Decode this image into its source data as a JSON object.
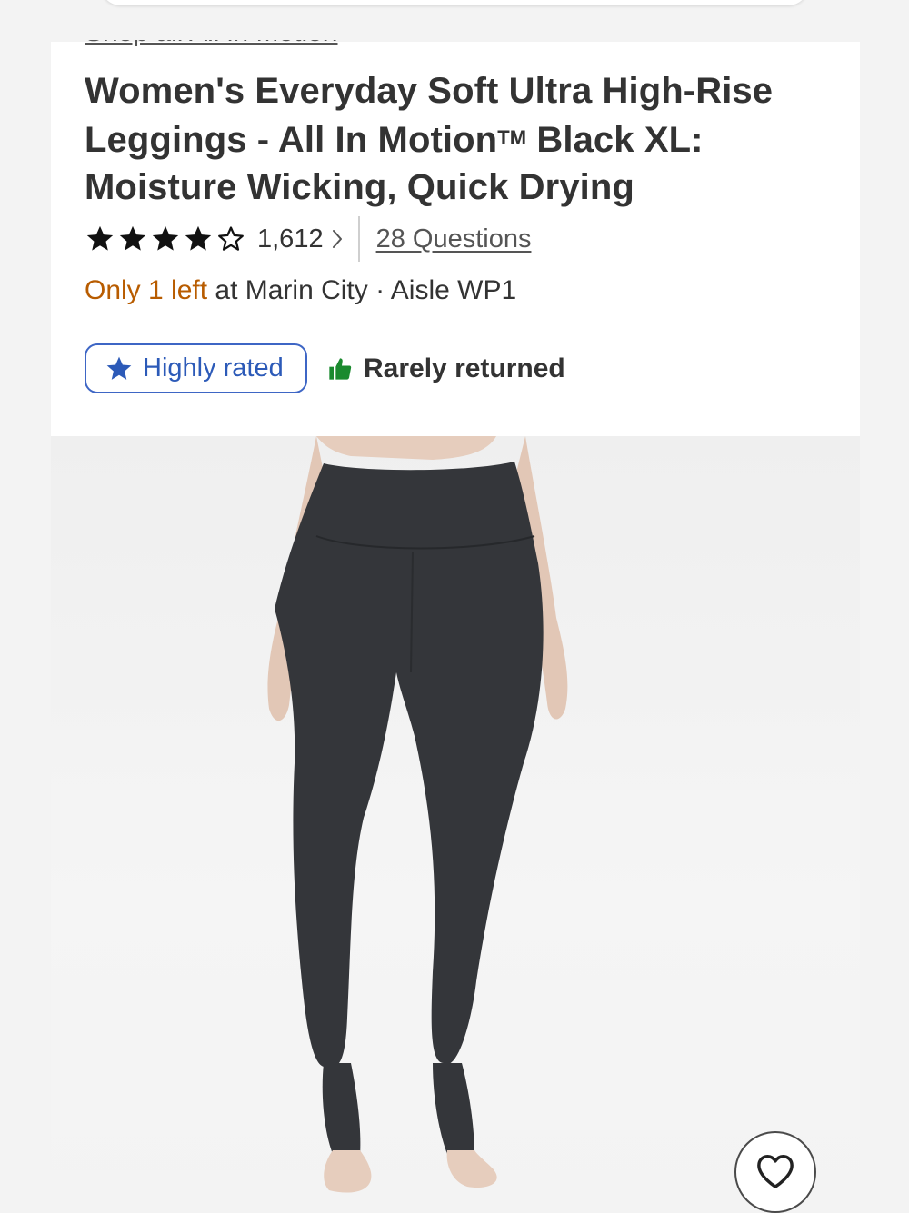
{
  "breadcrumb": {
    "shop_all_label": "Shop all All in Motion"
  },
  "product": {
    "title_line1": "Women's Everyday Soft Ultra High-Rise",
    "title_line2_pre": "Leggings - All In Motion",
    "title_tm": "TM",
    "title_line2_post": " Black XL:",
    "title_line3": "Moisture Wicking, Quick Drying",
    "rating": 4.5,
    "review_count": "1,612",
    "questions_label": "28 Questions"
  },
  "stock": {
    "highlight": "Only 1 left",
    "store_text": " at Marin City · Aisle WP1"
  },
  "badges": {
    "highly_rated": "Highly rated",
    "rarely_returned": "Rarely returned"
  },
  "colors": {
    "stock_highlight": "#b85c00",
    "badge_blue": "#2c5ab8",
    "thumb_green": "#1a8a2e"
  },
  "icons": {
    "rating": "star-icon",
    "chevron": "chevron-right-icon",
    "badge_star": "star-icon",
    "badge_thumb": "thumbs-up-icon",
    "favorite": "heart-icon"
  }
}
